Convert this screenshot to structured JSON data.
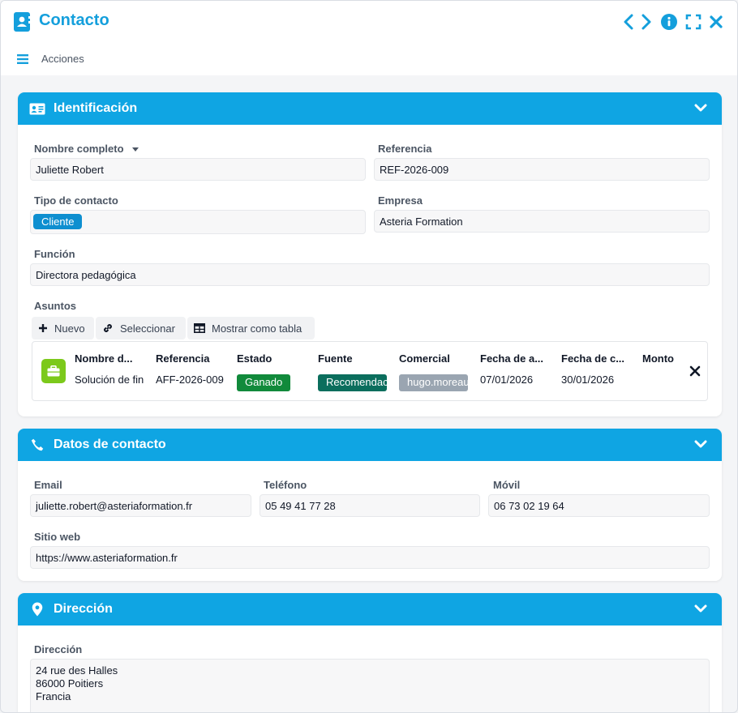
{
  "window": {
    "title": "Contacto",
    "actions_label": "Acciones"
  },
  "identificacion": {
    "title": "Identificación",
    "nombre_label": "Nombre completo",
    "nombre_value": "Juliette Robert",
    "referencia_label": "Referencia",
    "referencia_value": "REF-2026-009",
    "tipo_label": "Tipo de contacto",
    "tipo_value": "Cliente",
    "empresa_label": "Empresa",
    "empresa_value": "Asteria Formation",
    "funcion_label": "Función",
    "funcion_value": "Directora pedagógica",
    "asuntos_label": "Asuntos",
    "btn_nuevo": "Nuevo",
    "btn_seleccionar": "Seleccionar",
    "btn_tabla": "Mostrar como tabla",
    "table": {
      "headers": [
        "Nombre d...",
        "Referencia",
        "Estado",
        "Fuente",
        "Comercial",
        "Fecha de a...",
        "Fecha de c...",
        "Monto"
      ],
      "row": {
        "nombre": "Solución de fin",
        "referencia": "AFF-2026-009",
        "estado": "Ganado",
        "fuente": "Recomendación",
        "comercial": "hugo.moreau",
        "fecha_a": "07/01/2026",
        "fecha_c": "30/01/2026",
        "monto": ""
      }
    }
  },
  "datos": {
    "title": "Datos de contacto",
    "email_label": "Email",
    "email_value": "juliette.robert@asteriaformation.fr",
    "telefono_label": "Teléfono",
    "telefono_value": "05 49 41 77 28",
    "movil_label": "Móvil",
    "movil_value": "06 73 02 19 64",
    "web_label": "Sitio web",
    "web_value": "https://www.asteriaformation.fr"
  },
  "direccion": {
    "title": "Dirección",
    "label": "Dirección",
    "value": "24 rue des Halles\n86000 Poitiers\nFrancia"
  },
  "colors": {
    "accent": "#0fa5e3",
    "estado_badge": "#118a3b",
    "fuente_badge": "#0b6e5d",
    "comercial_badge": "#9aa5b1",
    "row_icon": "#7cc91b"
  }
}
